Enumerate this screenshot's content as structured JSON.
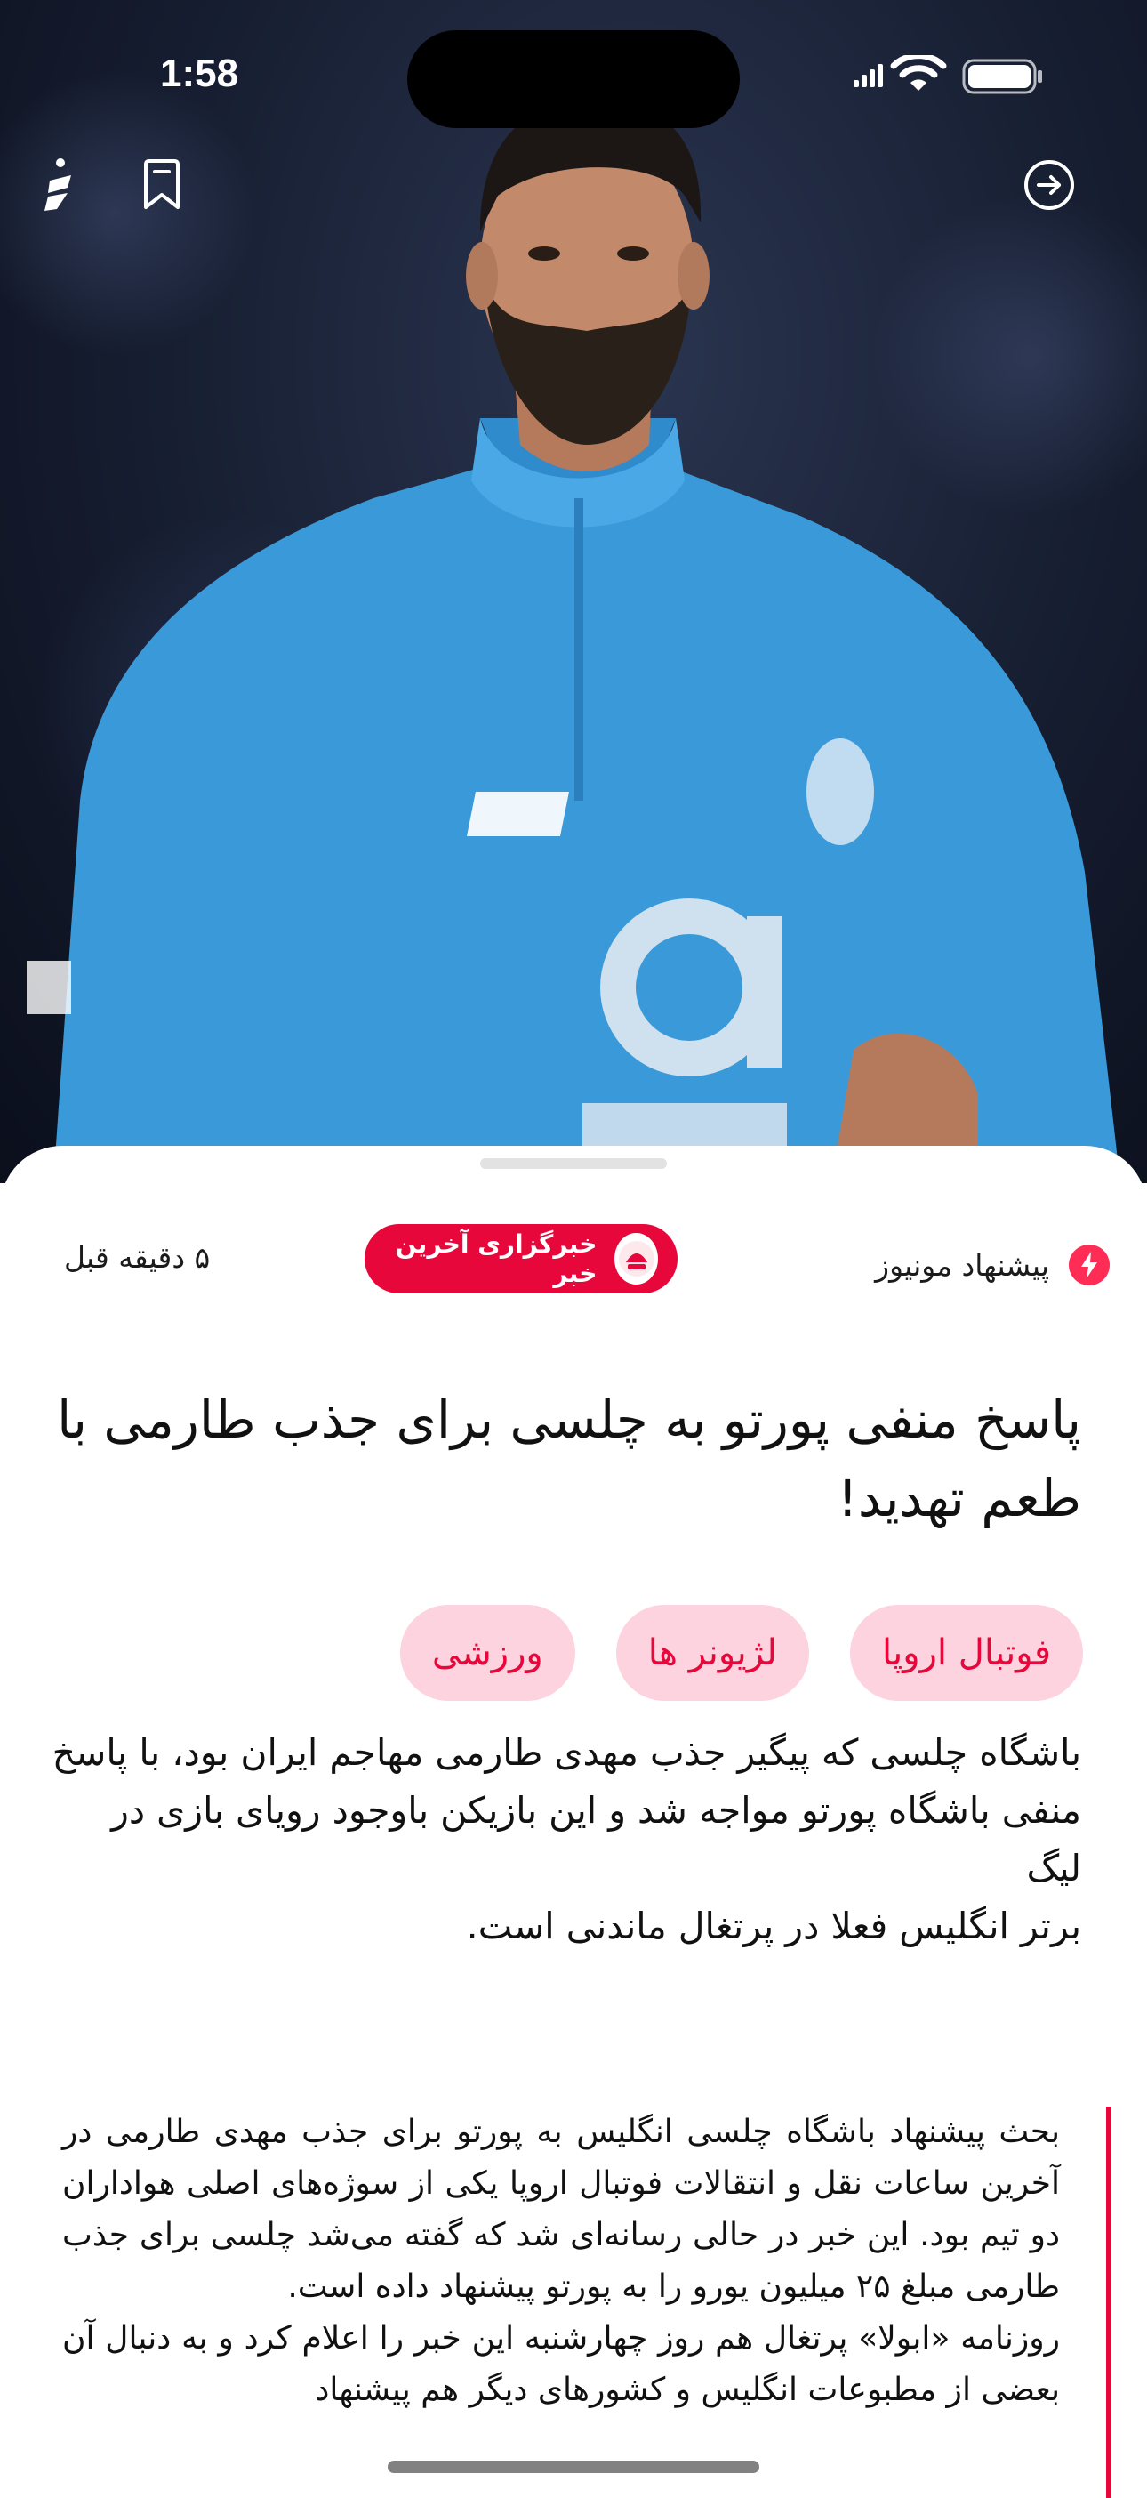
{
  "status_bar": {
    "time": "1:58"
  },
  "toolbar": {
    "font_button": "font-size-icon",
    "bookmark_button": "bookmark-icon",
    "back_button": "arrow-right-circle-icon"
  },
  "article": {
    "recommendation_label": "پیشنهاد مونیوز",
    "source_name": "خبرگزاری آخرین خبر",
    "time_ago": "۵ دقیقه قبل",
    "title": "پاسخ منفی پورتو به چلسی برای جذب طارمی با طعم تهدید!",
    "tags": [
      "فوتبال اروپا",
      "لژیونر ها",
      "ورزشی"
    ],
    "lead_lines": [
      "باشگاه چلسی که پیگیر جذب مهدی طارمی مهاجم ایران بود، با پاسخ",
      "منفی باشگاه پورتو مواجه شد و این بازیکن باوجود رویای بازی در لیگ",
      "برتر انگلیس فعلا در پرتغال ماندنی است."
    ],
    "body_paragraphs": [
      "بحث پیشنهاد باشگاه چلسی انگلیس به پورتو برای جذب مهدی طارمی در آخرین ساعات نقل و انتقالات فوتبال اروپا یکی از سوژه‌های اصلی هواداران دو تیم بود. این خبر در حالی رسانه‌ای شد که گفته می‌شد چلسی برای جذب طارمی مبلغ ۲۵ میلیون یورو را به پورتو پیشنهاد داده است.",
      "روزنامه «ابولا» پرتغال هم روز چهارشنبه این خبر را اعلام کرد و به دنبال آن بعضی از مطبوعات انگلیس و کشورهای دیگر هم پیشنهاد"
    ]
  },
  "colors": {
    "accent": "#e8073a",
    "tag_background": "#fcd3de",
    "hero_jersey": "#3a9ad9"
  }
}
